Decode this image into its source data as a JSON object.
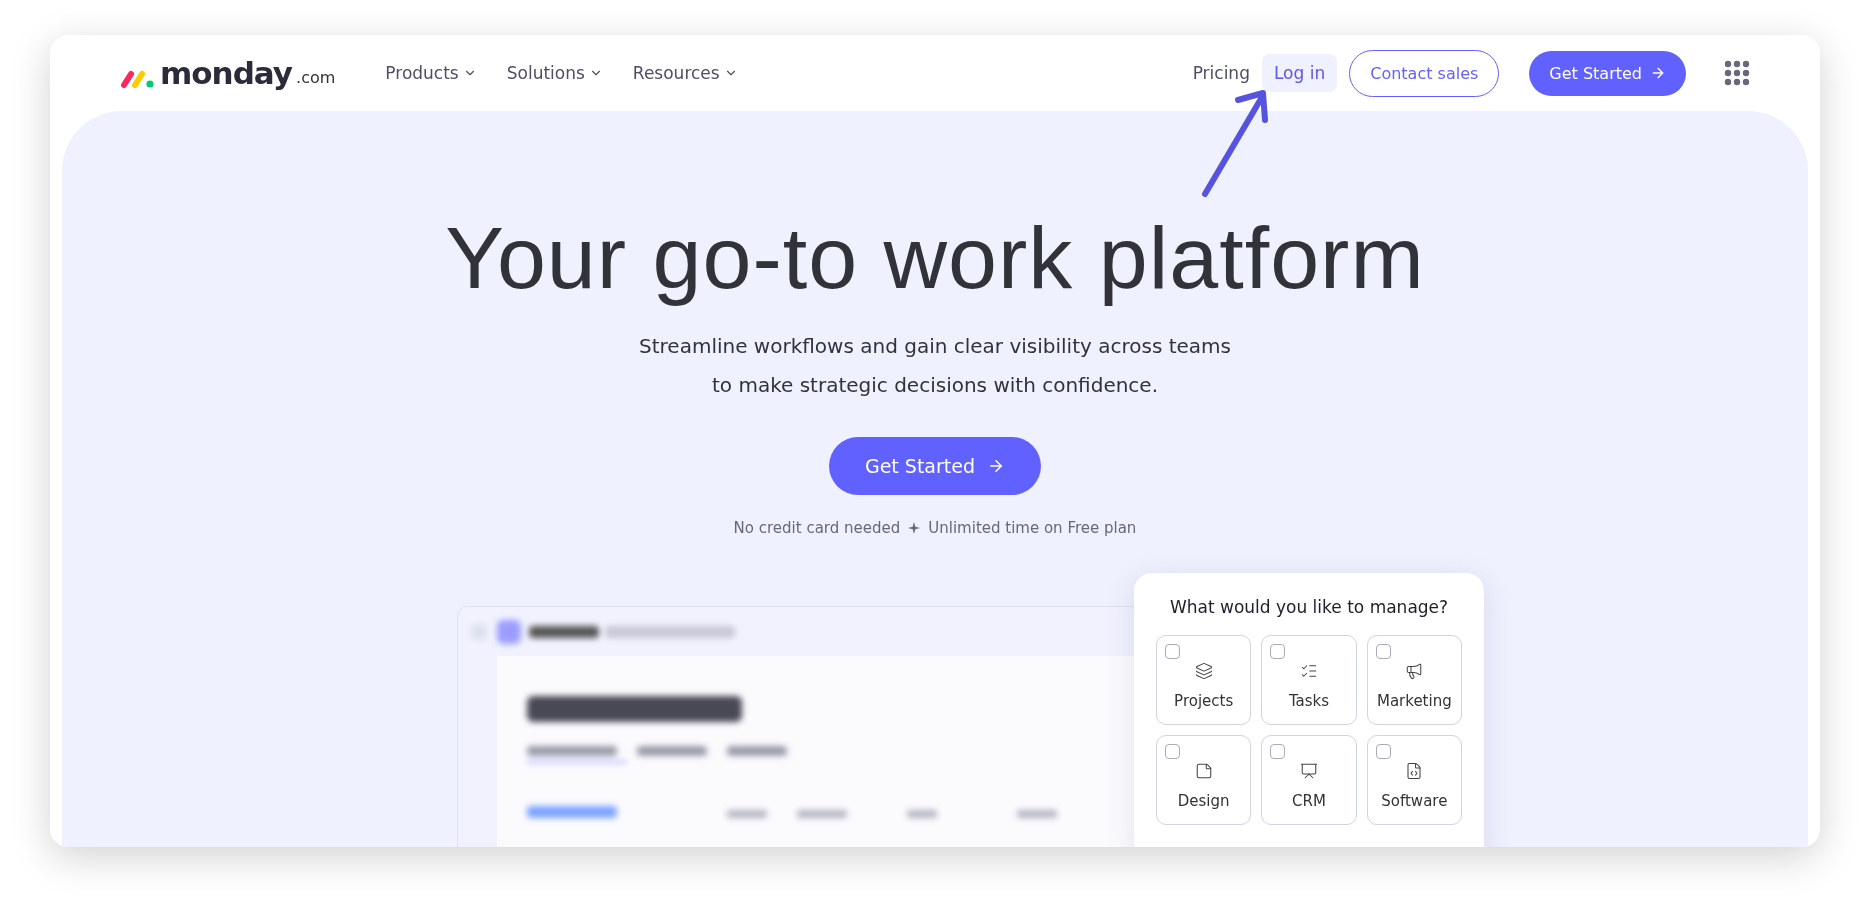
{
  "nav": {
    "logo": {
      "word": "monday",
      "suffix": ".com"
    },
    "menus": [
      {
        "label": "Products"
      },
      {
        "label": "Solutions"
      },
      {
        "label": "Resources"
      }
    ],
    "pricing": "Pricing",
    "login": "Log in",
    "contact": "Contact sales",
    "cta": "Get Started"
  },
  "hero": {
    "title": "Your go-to work platform",
    "subtitle": [
      "Streamline workflows and gain clear visibility across teams",
      "to make strategic decisions with confidence."
    ],
    "cta": "Get Started",
    "note": [
      "No credit card needed",
      "Unlimited time on Free plan"
    ]
  },
  "manage_card": {
    "title": "What would you like to manage?",
    "options": [
      {
        "label": "Projects",
        "checked": false
      },
      {
        "label": "Tasks",
        "checked": false
      },
      {
        "label": "Marketing",
        "checked": false
      },
      {
        "label": "Design",
        "checked": false
      },
      {
        "label": "CRM",
        "checked": false
      },
      {
        "label": "Software",
        "checked": false
      }
    ]
  }
}
